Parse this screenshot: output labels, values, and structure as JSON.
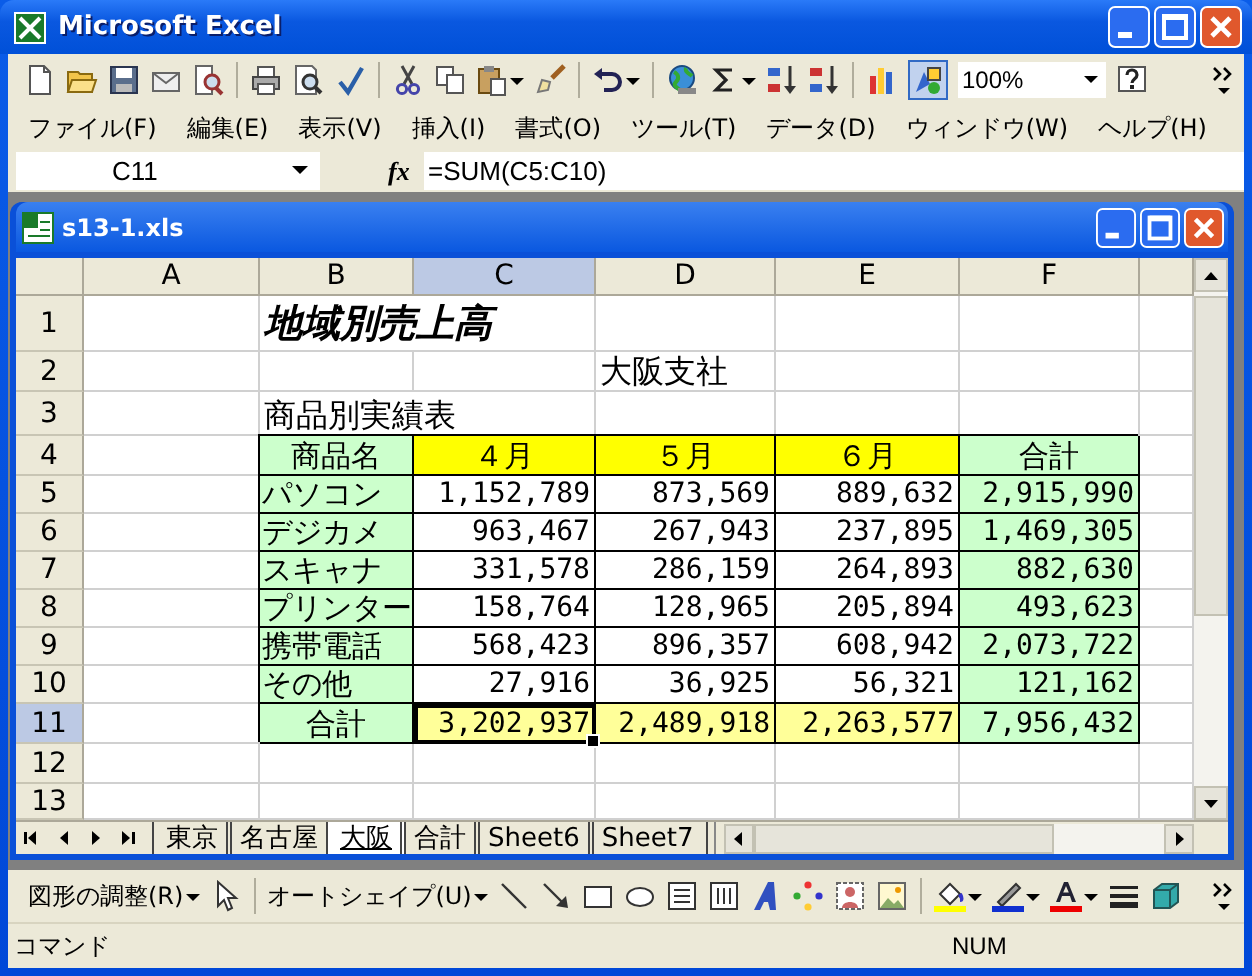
{
  "window": {
    "title": "Microsoft Excel"
  },
  "toolbar": {
    "zoom": "100%",
    "drawing_toggle_on": true
  },
  "menu": [
    "ファイル(F)",
    "編集(E)",
    "表示(V)",
    "挿入(I)",
    "書式(O)",
    "ツール(T)",
    "データ(D)",
    "ウィンドウ(W)",
    "ヘルプ(H)"
  ],
  "formula_bar": {
    "name_box": "C11",
    "fx": "fx",
    "formula": "=SUM(C5:C10)"
  },
  "workbook": {
    "title": "s13-1.xls"
  },
  "sheet": {
    "columns": [
      {
        "label": "A",
        "selected": false
      },
      {
        "label": "B",
        "selected": false
      },
      {
        "label": "C",
        "selected": true
      },
      {
        "label": "D",
        "selected": false
      },
      {
        "label": "E",
        "selected": false
      },
      {
        "label": "F",
        "selected": false
      }
    ],
    "rows": [
      {
        "label": "1",
        "selected": false,
        "cells": [
          {
            "selected": false
          },
          {
            "kind": "title",
            "text": "地域別売上高",
            "selected": false
          },
          {
            "selected": false
          },
          {
            "selected": false
          },
          {
            "selected": false
          }
        ]
      },
      {
        "label": "2",
        "selected": false,
        "cells": [
          {
            "selected": false
          },
          {
            "selected": false
          },
          {
            "selected": false
          },
          {
            "kind": "text",
            "text": "大阪支社",
            "selected": false
          },
          {
            "selected": false
          },
          {
            "selected": false
          }
        ]
      },
      {
        "label": "3",
        "selected": false,
        "cells": [
          {
            "selected": false
          },
          {
            "kind": "overflow_text",
            "text": "商品別実績表",
            "selected": false
          },
          {
            "selected": false
          },
          {
            "selected": false
          },
          {
            "selected": false
          }
        ]
      },
      {
        "label": "4",
        "selected": false,
        "cells": [
          {
            "selected": false
          },
          {
            "kind": "header",
            "text": "商品名",
            "color": "#ccffcc",
            "selected": false
          },
          {
            "kind": "header",
            "text": "４月",
            "color": "#ffff00",
            "selected": false
          },
          {
            "kind": "header",
            "text": "５月",
            "color": "#ffff00",
            "selected": false
          },
          {
            "kind": "header",
            "text": "６月",
            "color": "#ffff00",
            "selected": false
          },
          {
            "kind": "header",
            "text": "合計",
            "color": "#ccffcc",
            "selected": false
          }
        ]
      },
      {
        "label": "5",
        "selected": false,
        "cells": [
          {
            "selected": false
          },
          {
            "kind": "label",
            "text": "パソコン",
            "color": "#ccffcc",
            "selected": false
          },
          {
            "kind": "number",
            "text": "1,152,789",
            "selected": false
          },
          {
            "kind": "number",
            "text": "873,569",
            "selected": false
          },
          {
            "kind": "number",
            "text": "889,632",
            "selected": false
          },
          {
            "kind": "number",
            "text": "2,915,990",
            "color": "#ccffcc",
            "selected": false
          }
        ]
      },
      {
        "label": "6",
        "selected": false,
        "cells": [
          {
            "selected": false
          },
          {
            "kind": "label",
            "text": "デジカメ",
            "color": "#ccffcc",
            "selected": false
          },
          {
            "kind": "number",
            "text": "963,467",
            "selected": false
          },
          {
            "kind": "number",
            "text": "267,943",
            "selected": false
          },
          {
            "kind": "number",
            "text": "237,895",
            "selected": false
          },
          {
            "kind": "number",
            "text": "1,469,305",
            "color": "#ccffcc",
            "selected": false
          }
        ]
      },
      {
        "label": "7",
        "selected": false,
        "cells": [
          {
            "selected": false
          },
          {
            "kind": "label",
            "text": "スキャナ",
            "color": "#ccffcc",
            "selected": false
          },
          {
            "kind": "number",
            "text": "331,578",
            "selected": false
          },
          {
            "kind": "number",
            "text": "286,159",
            "selected": false
          },
          {
            "kind": "number",
            "text": "264,893",
            "selected": false
          },
          {
            "kind": "number",
            "text": "882,630",
            "color": "#ccffcc",
            "selected": false
          }
        ]
      },
      {
        "label": "8",
        "selected": false,
        "cells": [
          {
            "selected": false
          },
          {
            "kind": "label",
            "text": "プリンター",
            "color": "#ccffcc",
            "selected": false
          },
          {
            "kind": "number",
            "text": "158,764",
            "selected": false
          },
          {
            "kind": "number",
            "text": "128,965",
            "selected": false
          },
          {
            "kind": "number",
            "text": "205,894",
            "selected": false
          },
          {
            "kind": "number",
            "text": "493,623",
            "color": "#ccffcc",
            "selected": false
          }
        ]
      },
      {
        "label": "9",
        "selected": false,
        "cells": [
          {
            "selected": false
          },
          {
            "kind": "label",
            "text": "携帯電話",
            "color": "#ccffcc",
            "selected": false
          },
          {
            "kind": "number",
            "text": "568,423",
            "selected": false
          },
          {
            "kind": "number",
            "text": "896,357",
            "selected": false
          },
          {
            "kind": "number",
            "text": "608,942",
            "selected": false
          },
          {
            "kind": "number",
            "text": "2,073,722",
            "color": "#ccffcc",
            "selected": false
          }
        ]
      },
      {
        "label": "10",
        "selected": false,
        "cells": [
          {
            "selected": false
          },
          {
            "kind": "label",
            "text": "その他",
            "color": "#ccffcc",
            "selected": false
          },
          {
            "kind": "number",
            "text": "27,916",
            "selected": false
          },
          {
            "kind": "number",
            "text": "36,925",
            "selected": false
          },
          {
            "kind": "number",
            "text": "56,321",
            "selected": false
          },
          {
            "kind": "number",
            "text": "121,162",
            "color": "#ccffcc",
            "selected": false
          }
        ]
      },
      {
        "label": "11",
        "selected": true,
        "cells": [
          {
            "selected": false
          },
          {
            "kind": "header",
            "text": "合計",
            "color": "#ccffcc",
            "selected": false
          },
          {
            "kind": "number",
            "text": "3,202,937",
            "color": "#ffff99",
            "selected": true
          },
          {
            "kind": "number",
            "text": "2,489,918",
            "color": "#ffff99",
            "selected": false
          },
          {
            "kind": "number",
            "text": "2,263,577",
            "color": "#ffff99",
            "selected": false
          },
          {
            "kind": "number",
            "text": "7,956,432",
            "color": "#ccffcc",
            "selected": false
          }
        ]
      },
      {
        "label": "12",
        "selected": false,
        "cells": [
          {
            "selected": false
          },
          {
            "selected": false
          },
          {
            "selected": false
          },
          {
            "selected": false
          },
          {
            "selected": false
          },
          {
            "selected": false
          }
        ]
      },
      {
        "label": "13",
        "selected": false,
        "cells": [
          {
            "selected": false
          },
          {
            "selected": false
          },
          {
            "selected": false
          },
          {
            "selected": false
          },
          {
            "selected": false
          },
          {
            "selected": false
          }
        ]
      }
    ]
  },
  "sheet_tabs": [
    {
      "label": "東京",
      "selected": false
    },
    {
      "label": "名古屋",
      "selected": false
    },
    {
      "label": "大阪",
      "selected": true
    },
    {
      "label": "合計",
      "selected": false
    },
    {
      "label": "Sheet6",
      "selected": false
    },
    {
      "label": "Sheet7",
      "selected": false
    }
  ],
  "drawing_toolbar": {
    "draw_menu": "図形の調整(R)",
    "autoshapes_menu": "オートシェイプ(U)"
  },
  "status_bar": {
    "mode": "コマンド",
    "num_lock": "NUM"
  }
}
